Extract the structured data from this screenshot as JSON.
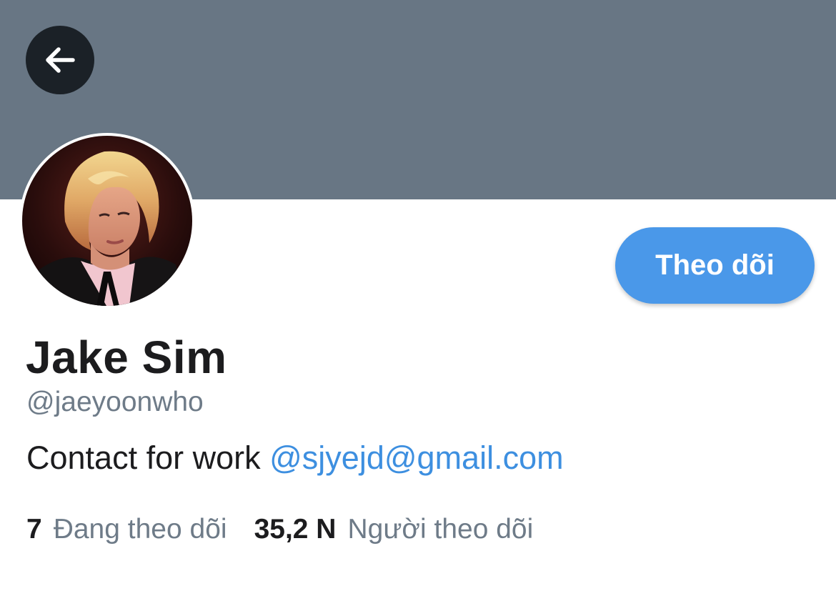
{
  "header": {
    "back_icon": "arrow-left-icon",
    "banner_color": "#687684"
  },
  "profile": {
    "avatar_alt": "profile photo",
    "display_name": "Jake Sim",
    "handle": "@jaeyoonwho",
    "bio_text": "Contact for work ",
    "bio_link": "@sjyejd@gmail.com"
  },
  "actions": {
    "follow_label": "Theo dõi",
    "follow_color": "#4a98e9"
  },
  "stats": {
    "following_count": "7",
    "following_label": "Đang theo dõi",
    "followers_count": "35,2 N",
    "followers_label": "Người theo dõi"
  },
  "colors": {
    "link": "#3d8fe0",
    "secondary_text": "#6e7b88",
    "primary_text": "#1c1c1e"
  }
}
